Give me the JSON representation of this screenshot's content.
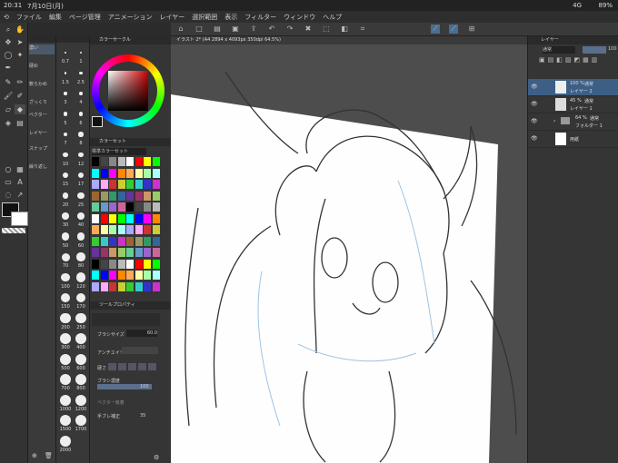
{
  "status": {
    "time": "20:31",
    "date": "7月10日(月)",
    "network": "4G",
    "battery": "89%"
  },
  "menu": [
    "ファイル",
    "編集",
    "ページ管理",
    "アニメーション",
    "レイヤー",
    "選択範囲",
    "表示",
    "フィルター",
    "ウィンドウ",
    "ヘルプ"
  ],
  "document_tab": "イラスト 2* (A4 2894 x 4093px 350dpi 64.5%)",
  "subtools": [
    "濃い",
    "硬め",
    "軟らかめ",
    "ざっくり",
    "ベクター",
    "レイヤー",
    "スナップ",
    "繰り返し"
  ],
  "brush_sizes": [
    "0.7",
    "1",
    "1.5",
    "2.5",
    "3",
    "4",
    "5",
    "6",
    "7",
    "8",
    "10",
    "12",
    "15",
    "17",
    "20",
    "25",
    "30",
    "40",
    "50",
    "60",
    "70",
    "80",
    "100",
    "120",
    "150",
    "170",
    "200",
    "250",
    "300",
    "400",
    "500",
    "600",
    "700",
    "800",
    "1000",
    "1200",
    "1500",
    "1700",
    "2000"
  ],
  "color_panel": {
    "title": "カラーサークル"
  },
  "color_set": {
    "title": "カラーセット",
    "dropdown": "標準カラーセット"
  },
  "tool_property": {
    "title": "ツールプロパティ",
    "brush_size_label": "ブラシサイズ",
    "brush_size_value": "60.0",
    "antialias_label": "アンチエイリ",
    "hardness_label": "硬さ",
    "density_label": "ブラシ濃度",
    "density_value": "100",
    "vector_label": "ベクター吸着",
    "stabilization_label": "手ブレ補正",
    "stabilization_value": "35"
  },
  "layers_panel": {
    "title": "レイヤー",
    "blend_mode": "通常",
    "opacity": "100",
    "layers": [
      {
        "opacity": "100 %",
        "mode": "通常",
        "name": "レイヤー 2",
        "selected": true
      },
      {
        "opacity": "45 %",
        "mode": "通常",
        "name": "レイヤー 1",
        "selected": false
      },
      {
        "opacity": "64 %",
        "mode": "通常",
        "name": "フォルダー 1",
        "selected": false
      },
      {
        "opacity": "",
        "mode": "",
        "name": "用紙",
        "selected": false
      }
    ]
  },
  "colors": {
    "accent": "#3a6ea5",
    "main_color": "#111111",
    "sub_color": "#ffffff",
    "selected_layer": "#3d5f86"
  },
  "icons": {
    "canvas_content": "sketch-illustration"
  }
}
